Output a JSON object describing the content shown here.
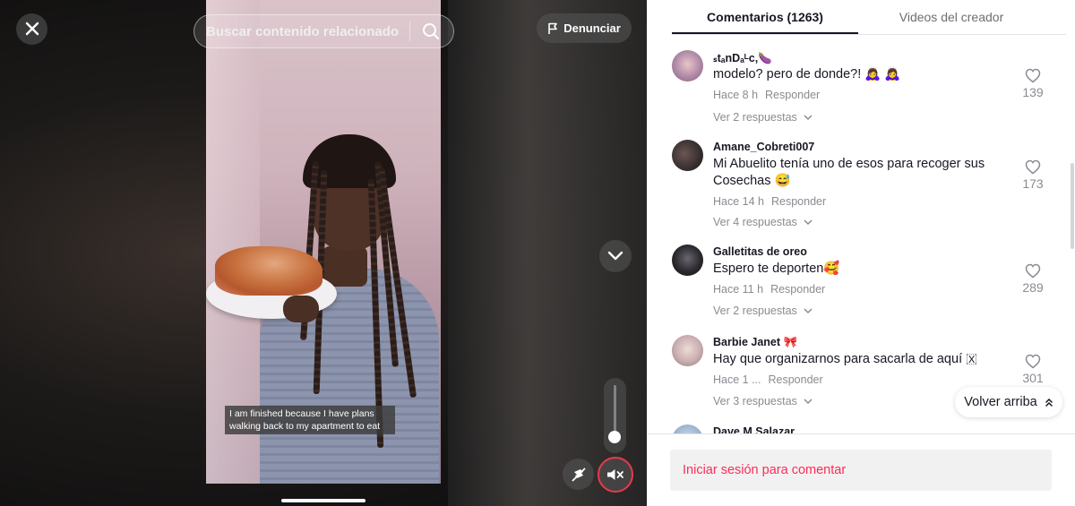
{
  "video": {
    "close_label": "✕",
    "search_placeholder": "Buscar contenido relacionado",
    "report_label": "Denunciar",
    "volume_level": 0.08,
    "muted": true,
    "subtitle_lines": [
      "I am finished because I have plans",
      "walking back to my apartment to eat"
    ]
  },
  "tabs": [
    {
      "label": "Comentarios (1263)",
      "active": true
    },
    {
      "label": "Videos del creador",
      "active": false
    }
  ],
  "comments": [
    {
      "user": "ₛtₐnDₐᴸc,🍆",
      "text": "modelo? pero de donde?! 🙇‍♀️ 🙇‍♀️",
      "time": "Hace 8 h",
      "reply_label": "Responder",
      "replies": "Ver 2 respuestas",
      "likes": "139",
      "avatar_color": "#b89ab0"
    },
    {
      "user": "Amane_Cobreti007",
      "text": "Mi Abuelito tenía uno de esos para recoger sus Cosechas 😅",
      "time": "Hace 14 h",
      "reply_label": "Responder",
      "replies": "Ver 4 respuestas",
      "likes": "173",
      "avatar_color": "#3b3232"
    },
    {
      "user": "Galletitas de oreo",
      "text": "Espero te deporten🥰",
      "time": "Hace 11 h",
      "reply_label": "Responder",
      "replies": "Ver 2 respuestas",
      "likes": "289",
      "avatar_color": "#2c2a2e"
    },
    {
      "user": "Barbie Janet 🎀",
      "text": "Hay que organizarnos para sacarla de aquí 🇽",
      "time": "Hace 1 ...",
      "reply_label": "Responder",
      "replies": "Ver 3 respuestas",
      "likes": "301",
      "avatar_color": "#c9aeb0"
    },
    {
      "user": "Dave M Salazar",
      "text": "",
      "time": "",
      "reply_label": "",
      "replies": "",
      "likes": "",
      "avatar_color": "#9fb6d4"
    }
  ],
  "back_to_top_label": "Volver arriba",
  "login_prompt": "Iniciar sesión para comentar",
  "colors": {
    "accent": "#fe2c55",
    "text": "#161823",
    "muted": "#8a8b91",
    "mute_ring": "#e9394f"
  },
  "icons": [
    "close-icon",
    "search-icon",
    "flag-icon",
    "chevron-down-icon",
    "quality-icon",
    "speaker-muted-icon",
    "heart-icon",
    "arrow-up-icon"
  ]
}
